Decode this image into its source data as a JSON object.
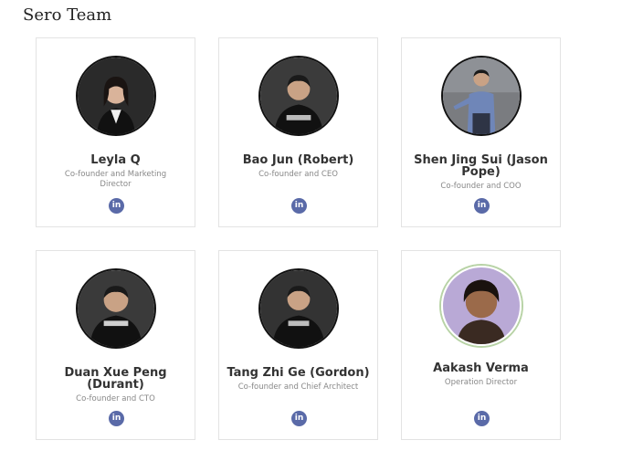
{
  "page": {
    "title": "Sero Team"
  },
  "members": [
    {
      "name": "Leyla Q",
      "role": "Co-founder and Marketing Director",
      "linkedin": "in"
    },
    {
      "name": "Bao Jun (Robert)",
      "role": "Co-founder and CEO",
      "linkedin": "in"
    },
    {
      "name": "Shen Jing Sui (Jason Pope)",
      "role": "Co-founder and COO",
      "linkedin": "in"
    },
    {
      "name": "Duan Xue Peng (Durant)",
      "role": "Co-founder and CTO",
      "linkedin": "in"
    },
    {
      "name": "Tang Zhi Ge (Gordon)",
      "role": "Co-founder and Chief Architect",
      "linkedin": "in"
    },
    {
      "name": "Aakash Verma",
      "role": "Operation Director",
      "linkedin": "in"
    }
  ],
  "colors": {
    "linkedin_button": "#5a6aa8",
    "card_border": "#e3e3e3",
    "avatar_ring_accent": "#b8d3a6"
  },
  "icons": {
    "linkedin": "linkedin-icon"
  }
}
